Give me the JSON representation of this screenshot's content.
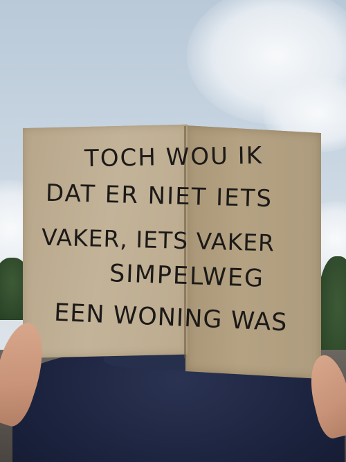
{
  "photo": {
    "description_free": true,
    "sign": {
      "lines": [
        "TOCH WOU IK",
        "DAT ER NIET IETS",
        "VAKER, IETS VAKER",
        "SIMPELWEG",
        "EEN WONING WAS"
      ]
    }
  },
  "colors": {
    "sky": "#c9d6e2",
    "cardboard": "#c3b398",
    "ink": "#1c1a18",
    "shirt": "#1d2440"
  }
}
